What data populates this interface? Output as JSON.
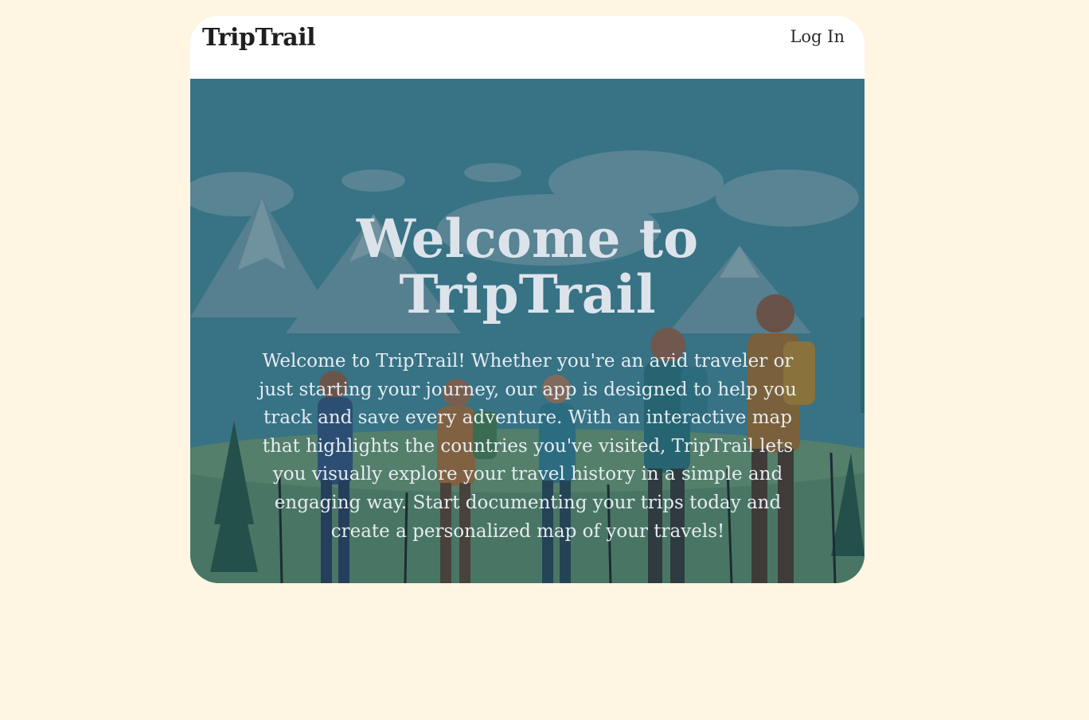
{
  "nav": {
    "brand": "TripTrail",
    "login_label": "Log In"
  },
  "hero": {
    "title": "Welcome to TripTrail",
    "description": "Welcome to TripTrail! Whether you're an avid traveler or just starting your journey, our app is designed to help you track and save every adventure. With an interactive map that highlights the countries you've visited, TripTrail lets you visually explore your travel history in a simple and engaging way. Start documenting your trips today and create a personalized map of your travels!",
    "background_image": "hikers-mountain-illustration"
  },
  "colors": {
    "page_background": "#fef5e3",
    "navbar_background": "#ffffff",
    "hero_overlay": "#2f6577"
  }
}
